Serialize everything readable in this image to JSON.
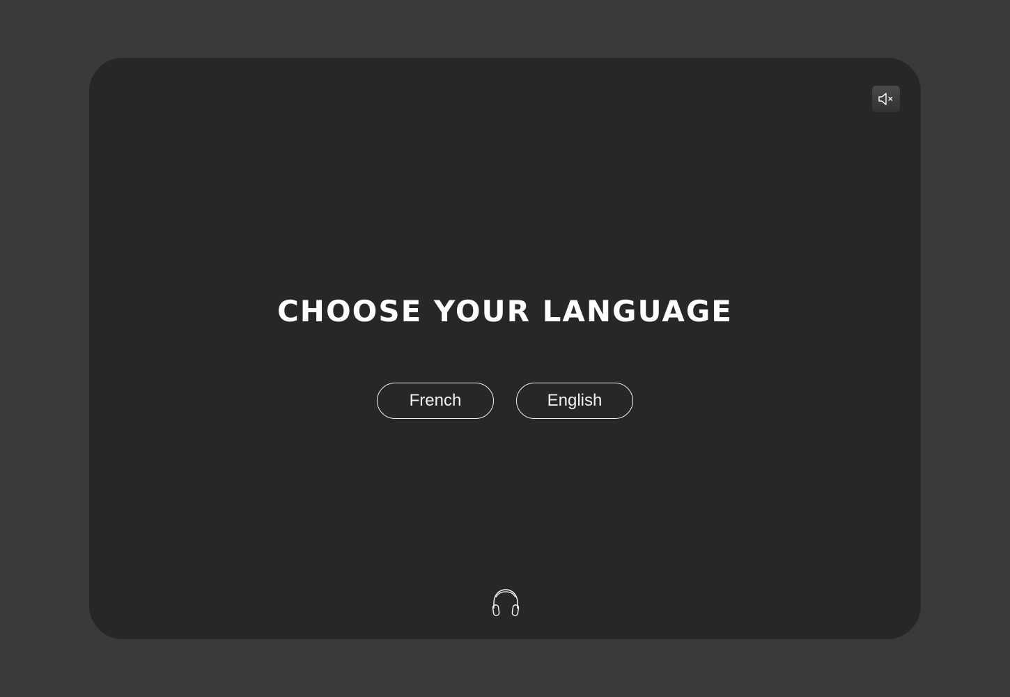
{
  "screen": {
    "title": "CHOOSE YOUR LANGUAGE"
  },
  "languages": {
    "options": [
      {
        "label": "French"
      },
      {
        "label": "English"
      }
    ]
  },
  "controls": {
    "mute_icon": "speaker-muted-icon",
    "audio_icon": "headphones-icon"
  },
  "colors": {
    "page_background": "#3a3a3a",
    "panel_background": "#282627",
    "foreground": "#ffffff"
  }
}
